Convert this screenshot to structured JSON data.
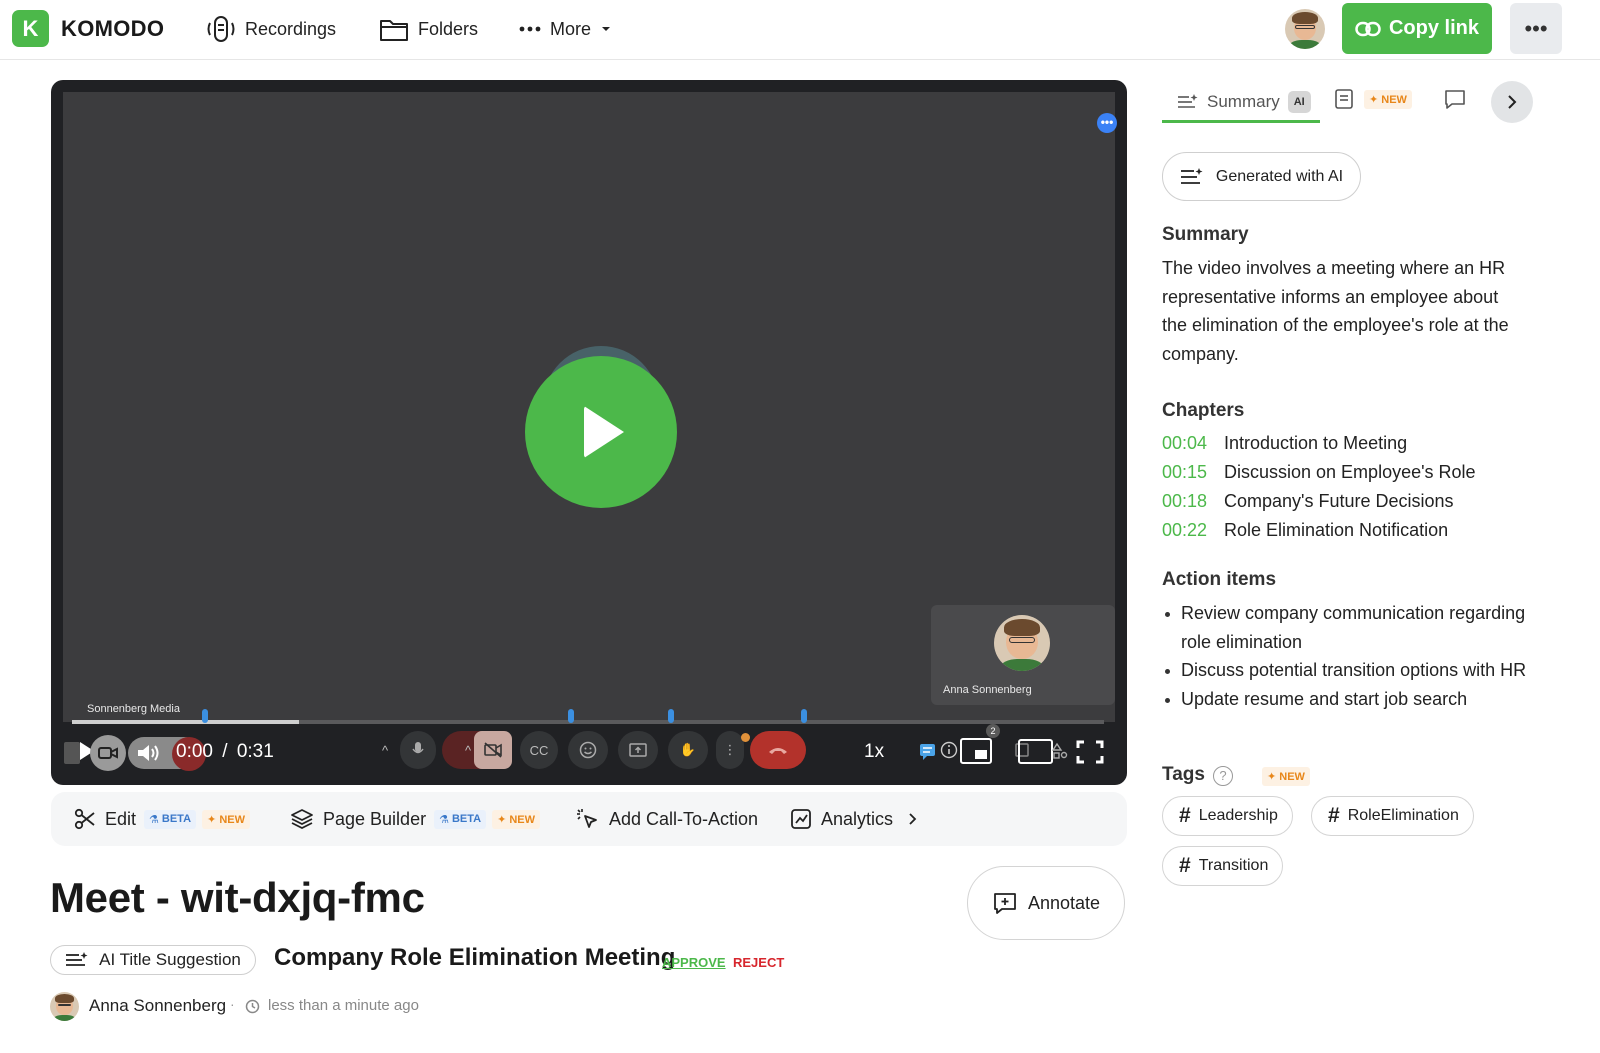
{
  "header": {
    "logo_letter": "K",
    "brand": "KOMODO",
    "nav": [
      {
        "label": "Recordings",
        "icon": "recordings-icon"
      },
      {
        "label": "Folders",
        "icon": "folder-icon"
      },
      {
        "label": "More",
        "icon": "more-dots-icon"
      }
    ],
    "copy_link": "Copy link",
    "more_menu": "•••",
    "accent": "#4cb84a"
  },
  "video": {
    "menu_dots": "•••",
    "participant_name": "Anna Sonnenberg",
    "source_label": "Sonnenberg Media",
    "current_time": "0:00",
    "separator": "/",
    "duration": "0:31",
    "progress_fraction": 0.22,
    "chapter_markers_seconds": [
      4,
      15,
      18,
      22
    ],
    "speed": "1x",
    "participants_count": "2"
  },
  "actions": {
    "edit": "Edit",
    "page_builder": "Page Builder",
    "add_cta": "Add Call-To-Action",
    "analytics": "Analytics",
    "beta": "BETA",
    "new": "✦ NEW"
  },
  "title": {
    "main": "Meet - wit-dxjq-fmc",
    "annotate": "Annotate",
    "ai_title_suggestion": "AI Title Suggestion",
    "suggested": "Company Role Elimination Meeting",
    "approve": "APPROVE",
    "reject": "REJECT",
    "author": "Anna Sonnenberg",
    "separator": "·",
    "time_ago": "less than a minute ago"
  },
  "panel": {
    "tab_summary": "Summary",
    "ai_chip": "AI",
    "new_badge": "✦ NEW",
    "generated": "Generated with AI",
    "summary_head": "Summary",
    "summary_text": "The video involves a meeting where an HR representative informs an employee about the elimination of the employee's role at the company.",
    "chapters_head": "Chapters",
    "chapters": [
      {
        "time": "00:04",
        "title": "Introduction to Meeting"
      },
      {
        "time": "00:15",
        "title": "Discussion on Employee's Role"
      },
      {
        "time": "00:18",
        "title": "Company's Future Decisions"
      },
      {
        "time": "00:22",
        "title": "Role Elimination Notification"
      }
    ],
    "action_head": "Action items",
    "action_items": [
      "Review company communication regarding role elimination",
      "Discuss potential transition options with HR",
      "Update resume and start job search"
    ],
    "tags_head": "Tags",
    "tags_help": "?",
    "tags_new": "✦ NEW",
    "tags": [
      "Leadership",
      "RoleElimination",
      "Transition"
    ]
  }
}
